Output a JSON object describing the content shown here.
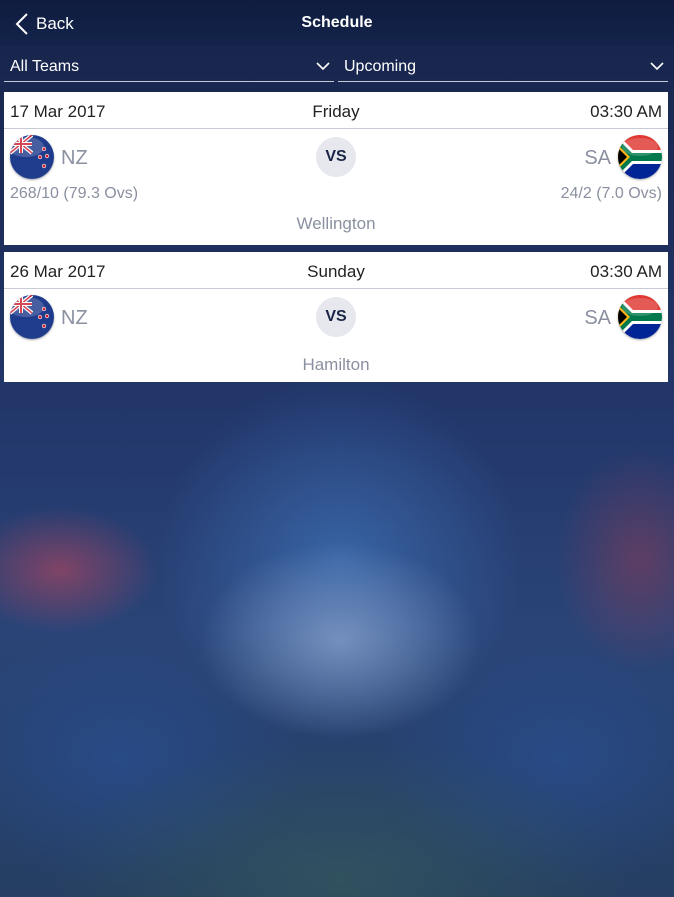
{
  "header": {
    "back_label": "Back",
    "title": "Schedule"
  },
  "filters": {
    "team": "All Teams",
    "status": "Upcoming"
  },
  "matches": [
    {
      "date": "17 Mar 2017",
      "day": "Friday",
      "time": "03:30 AM",
      "team1": {
        "abbr": "NZ",
        "flag": "new-zealand-flag-icon",
        "score": "268/10 (79.3 Ovs)"
      },
      "team2": {
        "abbr": "SA",
        "flag": "south-africa-flag-icon",
        "score": "24/2 (7.0 Ovs)"
      },
      "vs": "VS",
      "venue": "Wellington"
    },
    {
      "date": "26 Mar 2017",
      "day": "Sunday",
      "time": "03:30 AM",
      "team1": {
        "abbr": "NZ",
        "flag": "new-zealand-flag-icon"
      },
      "team2": {
        "abbr": "SA",
        "flag": "south-africa-flag-icon"
      },
      "vs": "VS",
      "venue": "Hamilton"
    }
  ],
  "colors": {
    "header": "#0f1c40",
    "card": "#ffffff",
    "muted_text": "#8a90a0",
    "vs_text": "#1a2445"
  }
}
